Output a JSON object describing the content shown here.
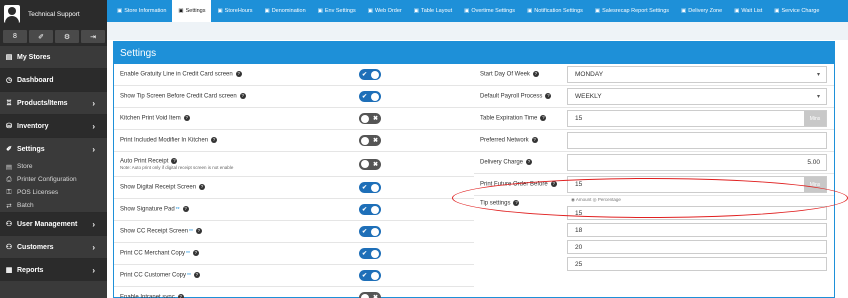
{
  "user": {
    "name": "Technical Support"
  },
  "sidebar": {
    "icon_buttons": [
      "8",
      "✐",
      "⚙",
      "⇥"
    ],
    "items": [
      {
        "label": "My Stores",
        "icon": "store-icon",
        "glyph": "▤",
        "arrow": ""
      },
      {
        "label": "Dashboard",
        "icon": "dashboard-icon",
        "glyph": "◷",
        "arrow": ""
      },
      {
        "label": "Products/Items",
        "icon": "products-icon",
        "glyph": "♖",
        "arrow": "›"
      },
      {
        "label": "Inventory",
        "icon": "inventory-icon",
        "glyph": "⛁",
        "arrow": "›"
      },
      {
        "label": "Settings",
        "icon": "settings-icon",
        "glyph": "✐",
        "arrow": "›"
      }
    ],
    "subitems": [
      {
        "label": "Store",
        "glyph": "▤"
      },
      {
        "label": "Printer Configuration",
        "glyph": "⎙"
      },
      {
        "label": "POS Licenses",
        "glyph": "⚿"
      },
      {
        "label": "Batch",
        "glyph": "⇄"
      }
    ],
    "items2": [
      {
        "label": "User Management",
        "glyph": "⚇",
        "arrow": "›"
      },
      {
        "label": "Customers",
        "glyph": "⚇",
        "arrow": "›"
      },
      {
        "label": "Reports",
        "glyph": "▦",
        "arrow": "›"
      }
    ]
  },
  "tabs": [
    {
      "label": "Store Information",
      "active": false
    },
    {
      "label": "Settings",
      "active": true
    },
    {
      "label": "StoreHours",
      "active": false
    },
    {
      "label": "Denomination",
      "active": false
    },
    {
      "label": "Env Settings",
      "active": false
    },
    {
      "label": "Web Order",
      "active": false
    },
    {
      "label": "Table Layout",
      "active": false
    },
    {
      "label": "Overtime Settings",
      "active": false
    },
    {
      "label": "Notification Settings",
      "active": false
    },
    {
      "label": "Salesrecap Report Settings",
      "active": false
    },
    {
      "label": "Delivery Zone",
      "active": false
    },
    {
      "label": "Wait List",
      "active": false
    },
    {
      "label": "Service Charge",
      "active": false
    }
  ],
  "panel": {
    "title": "Settings"
  },
  "left_settings": [
    {
      "label": "Enable Gratuity Line in Credit Card screen",
      "stars": "",
      "on": true,
      "note": ""
    },
    {
      "label": "Show Tip Screen Before Credit Card screen",
      "stars": "",
      "on": true,
      "note": ""
    },
    {
      "label": "Kitchen Print Void Item",
      "stars": "",
      "on": false,
      "note": ""
    },
    {
      "label": "Print Included Modifier In Kitchen",
      "stars": "",
      "on": false,
      "note": ""
    },
    {
      "label": "Auto Print Receipt",
      "stars": "",
      "on": false,
      "note": "Note: Auto print only if digital receipt screen is not enable"
    },
    {
      "label": "Show Digital Receipt Screen",
      "stars": "",
      "on": true,
      "note": ""
    },
    {
      "label": "Show Signature Pad",
      "stars": "**",
      "on": true,
      "note": ""
    },
    {
      "label": "Show CC Receipt Screen",
      "stars": "**",
      "on": true,
      "note": ""
    },
    {
      "label": "Print CC Merchant Copy",
      "stars": "**",
      "on": true,
      "note": ""
    },
    {
      "label": "Print CC Customer Copy",
      "stars": "**",
      "on": true,
      "note": ""
    },
    {
      "label": "Enable Intranet sync",
      "stars": "",
      "on": false,
      "note": ""
    }
  ],
  "right_settings": {
    "start_day": {
      "label": "Start Day Of Week",
      "value": "MONDAY"
    },
    "payroll": {
      "label": "Default Payroll Process",
      "value": "WEEKLY"
    },
    "table_exp": {
      "label": "Table Expiration Time",
      "value": "15",
      "unit": "Mins"
    },
    "network": {
      "label": "Preferred Network",
      "value": ""
    },
    "delivery": {
      "label": "Delivery Charge",
      "value": "5.00"
    },
    "future": {
      "label": "Print Future Order Before",
      "value": "15",
      "unit": "Mins"
    },
    "tips": {
      "label": "Tip settings",
      "legend": "◉ Amount ◎ Percentage",
      "values": [
        "15",
        "18",
        "20",
        "25"
      ]
    }
  },
  "colors": {
    "accent": "#1e90d8",
    "highlight": "#e02020",
    "sidebar": "#3a3a3a"
  }
}
